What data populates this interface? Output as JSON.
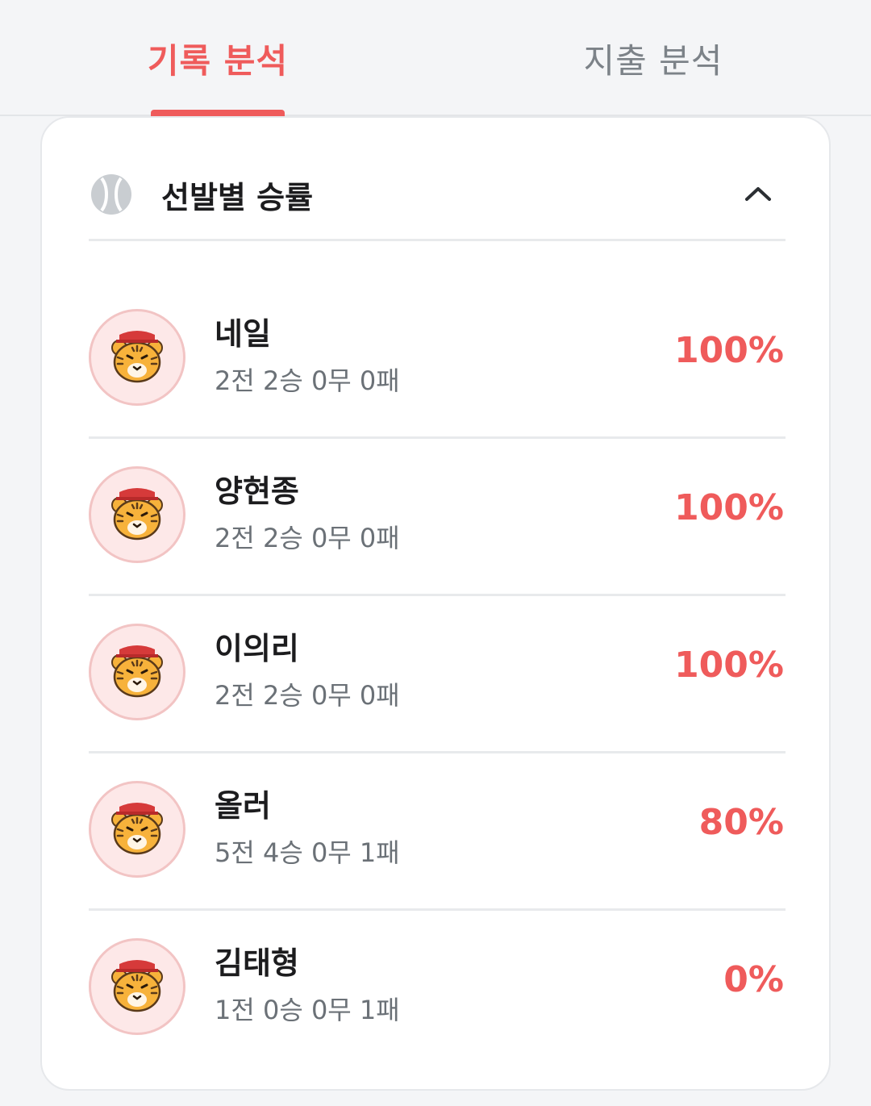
{
  "tabs": [
    {
      "label": "기록 분석",
      "active": true
    },
    {
      "label": "지출 분석",
      "active": false
    }
  ],
  "card": {
    "title": "선발별 승률",
    "icon": "baseball-icon",
    "collapse_icon": "chevron-up-icon"
  },
  "players": [
    {
      "name": "네일",
      "record": "2전 2승 0무 0패",
      "win_rate": "100%"
    },
    {
      "name": "양현종",
      "record": "2전 2승 0무 0패",
      "win_rate": "100%"
    },
    {
      "name": "이의리",
      "record": "2전 2승 0무 0패",
      "win_rate": "100%"
    },
    {
      "name": "올러",
      "record": "5전 4승 0무 1패",
      "win_rate": "80%"
    },
    {
      "name": "김태형",
      "record": "1전 0승 0무 1패",
      "win_rate": "0%"
    }
  ],
  "colors": {
    "accent": "#ef5b5b",
    "inactive_tab": "#7c8288",
    "avatar_bg": "#fde8e8"
  }
}
